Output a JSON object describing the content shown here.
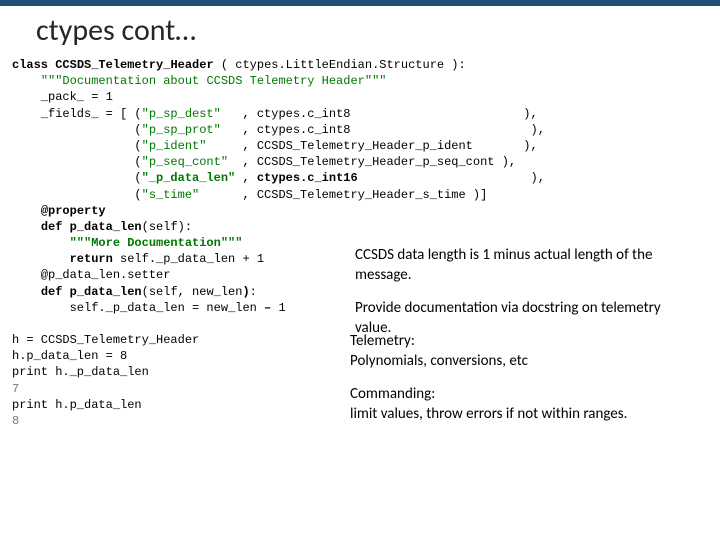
{
  "title": "ctypes cont…",
  "code1_html": "<span class=\"kw\">class</span> <span class=\"kw\">CCSDS_Telemetry_Header</span> ( ctypes.LittleEndian.Structure ):\n    <span class=\"grn\">\"\"\"Documentation about CCSDS Telemetry Header\"\"\"</span>\n    _pack_ = 1\n    _fields_ = [ (<span class=\"grn\">\"p_sp_dest\"</span>   , ctypes.c_int8                        ),\n                 (<span class=\"grn\">\"p_sp_prot\"</span>   , ctypes.c_int8                         ),\n                 (<span class=\"grn\">\"p_ident\"</span>     , CCSDS_Telemetry_Header_p_ident       ),\n                 (<span class=\"grn\">\"p_seq_cont\"</span>  , CCSDS_Telemetry_Header_p_seq_cont ),\n                 (<span class=\"grn kw\">\"_p_data_len\"</span> , <span class=\"kw\">ctypes.c_int16</span>                        ),\n                 (<span class=\"grn\">\"s_time\"</span>      , CCSDS_Telemetry_Header_s_time )]\n    <span class=\"kw\">@property</span>\n    <span class=\"kw\">def p_data_len</span>(self):\n        <span class=\"grn kw\">\"\"\"More Documentation\"\"\"</span>\n        <span class=\"kw\">return</span> self._p_data_len + 1\n    @p_data_len.setter\n    <span class=\"kw\">def p_data_len</span>(self, new_len<span class=\"kw\">)</span>:\n        self._p_data_len = new_len <span class=\"kw\">–</span> 1",
  "code2_html": "h = CCSDS_Telemetry_Header\nh.p_data_len = 8\nprint h._p_data_len\n<span class=\"gry\">7</span>\nprint h.p_data_len\n<span class=\"gry\">8</span>",
  "ann": {
    "a1": "CCSDS data length is 1 minus actual length of the message.",
    "a2": "Provide documentation via docstring on telemetry value.",
    "a3a": "Telemetry:",
    "a3b": "Polynomials, conversions, etc",
    "a4a": "Commanding:",
    "a4b": "limit values, throw errors if not within ranges."
  }
}
